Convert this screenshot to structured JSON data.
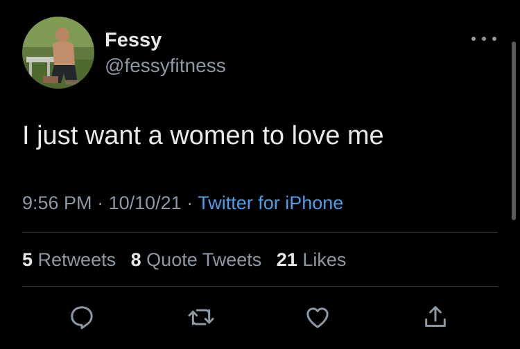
{
  "tweet": {
    "author": {
      "display_name": "Fessy",
      "handle": "@fessyfitness"
    },
    "text": "I just want a women to love me",
    "time": "9:56 PM",
    "date": "10/10/21",
    "separator": "·",
    "source": "Twitter for iPhone"
  },
  "stats": {
    "retweets_count": "5",
    "retweets_label": "Retweets",
    "quote_tweets_count": "8",
    "quote_tweets_label": "Quote Tweets",
    "likes_count": "21",
    "likes_label": "Likes"
  },
  "actions": [
    {
      "icon": "reply-icon"
    },
    {
      "icon": "retweet-icon"
    },
    {
      "icon": "like-icon"
    },
    {
      "icon": "share-icon"
    }
  ],
  "colors": {
    "background": "#000000",
    "primary_text": "#e7e9ea",
    "secondary_text": "#8b98a5",
    "link": "#4a9eea",
    "divider": "#2f3336"
  }
}
